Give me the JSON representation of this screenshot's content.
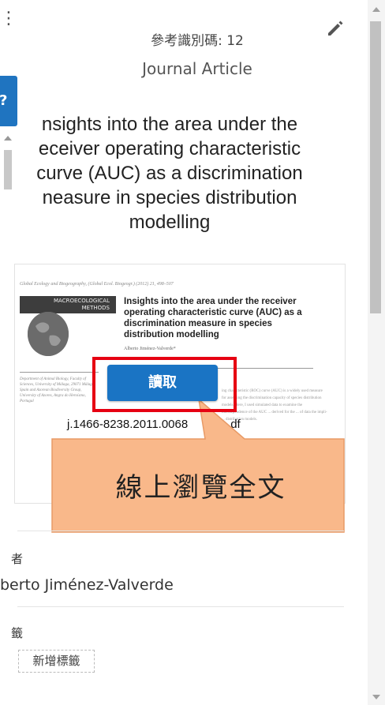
{
  "header": {
    "ref_label": "參考識別碼: 12",
    "article_type": "Journal Article",
    "title_lines": [
      "nsights into the area under the",
      "eceiver operating characteristic",
      "curve (AUC) as a discrimination",
      "neasure in species distribution",
      "modelling"
    ]
  },
  "preview": {
    "journal_line": "Global Ecology and Biogeography, (Global Ecol. Biogeogr.) (2012) 21, 498–507",
    "badge_lines": [
      "MACROECOLOGICAL",
      "METHODS"
    ],
    "title_lines": [
      "Insights into the area under the receiver",
      "operating characteristic curve (AUC) as a",
      "discrimination measure in species",
      "distribution modelling"
    ],
    "author": "Alberto Jiménez-Valverde*",
    "affiliation": "Department of Animal Biology, Faculty of Sciences, University of Málaga, 29071 Málaga, Spain and Azorean Biodiversity Group, University of Azores, Angra do Heroísmo, Portugal",
    "abstract": "ing characteristic (ROC) curve (AUC) is a widely used measure for assessing the discrimination capacity of species distribution models. Here, I used simulated data to examine the interdependence of the AUC ... derived for the ... of data the impli- ... distribution models.",
    "doi": "j.1466-8238.2011.0068",
    "doi_tail": "df"
  },
  "read_button": {
    "label": "讀取"
  },
  "callout": {
    "text": "線上瀏覽全文",
    "fill": "#f9b88a",
    "stroke": "#e89a66"
  },
  "author_section": {
    "label": "者",
    "value": "berto Jiménez-Valverde"
  },
  "tags_section": {
    "label": "籤",
    "add_label": "新增標籤"
  },
  "colors": {
    "accent": "#1a74c4",
    "highlight": "#e60012"
  },
  "icons": {
    "edit": "pencil-icon",
    "menu": "more-vert-icon",
    "help": "help-icon"
  }
}
